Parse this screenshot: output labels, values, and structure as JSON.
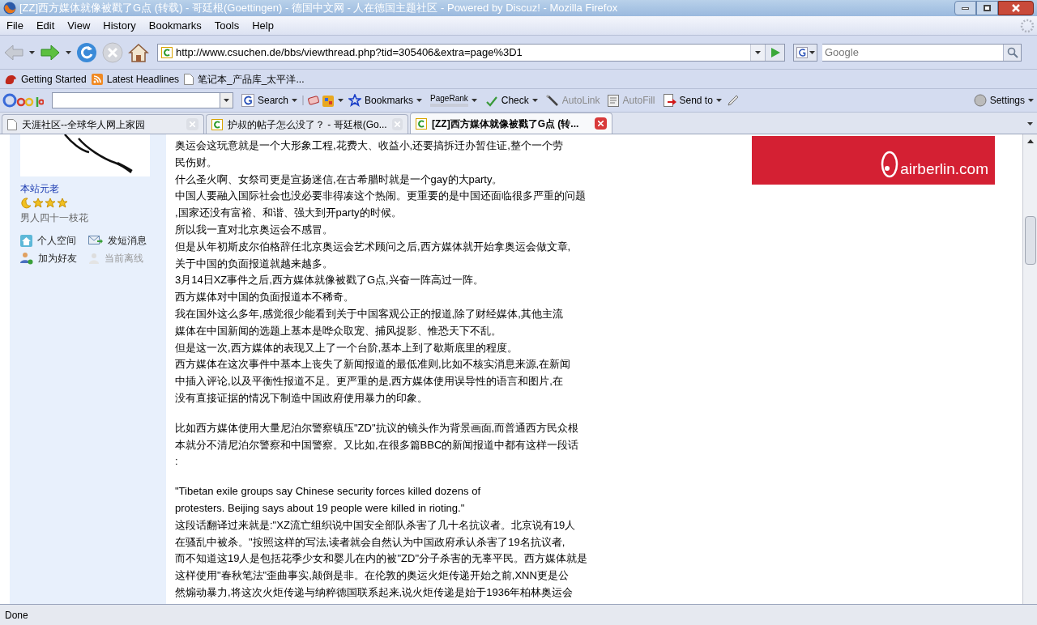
{
  "window": {
    "title": "[ZZ]西方媒体就像被戳了G点 (转载) - 哥廷根(Goettingen) - 德国中文网 - 人在德国主题社区 - Powered by Discuz! - Mozilla Firefox"
  },
  "menu": [
    "File",
    "Edit",
    "View",
    "History",
    "Bookmarks",
    "Tools",
    "Help"
  ],
  "address": {
    "value": "http://www.csuchen.de/bbs/viewthread.php?tid=305406&extra=page%3D1"
  },
  "search": {
    "placeholder": "Google"
  },
  "bookmarks": [
    {
      "label": "Getting Started",
      "kind": "firefox"
    },
    {
      "label": "Latest Headlines",
      "kind": "feed"
    },
    {
      "label": "笔记本_产品库_太平洋...",
      "kind": "page"
    }
  ],
  "google_toolbar": {
    "items": [
      {
        "label": "Search",
        "kind": "search",
        "disabled": false
      },
      {
        "label": "Bookmarks",
        "kind": "bookmarks",
        "disabled": false
      },
      {
        "label": "PageRank",
        "kind": "pagerank",
        "disabled": false
      },
      {
        "label": "Check",
        "kind": "check",
        "disabled": false
      },
      {
        "label": "AutoLink",
        "kind": "autolink",
        "disabled": true
      },
      {
        "label": "AutoFill",
        "kind": "autofill",
        "disabled": true
      },
      {
        "label": "Send to",
        "kind": "sendto",
        "disabled": false
      }
    ],
    "settings": "Settings"
  },
  "tabs": [
    {
      "label": "天涯社区--全球华人网上家园",
      "selected": false,
      "kind": "page"
    },
    {
      "label": "护叔的帖子怎么没了？ - 哥廷根(Go...",
      "selected": false,
      "kind": "site"
    },
    {
      "label": "[ZZ]西方媒体就像被戳了G点 (转...",
      "selected": true,
      "kind": "site"
    }
  ],
  "author": {
    "rank": "本站元老",
    "nickname": "男人四十一枝花",
    "actions": [
      {
        "label": "个人空间",
        "kind": "home",
        "disabled": false
      },
      {
        "label": "发短消息",
        "kind": "message",
        "disabled": false
      },
      {
        "label": "加为好友",
        "kind": "friend",
        "disabled": false
      },
      {
        "label": "当前离线",
        "kind": "offline",
        "disabled": true
      }
    ]
  },
  "ad": {
    "text": "airberlin.com"
  },
  "post": {
    "paragraphs": [
      [
        "奥运会这玩意就是一个大形象工程,花费大、收益小,还要搞拆迁办暂住证,整个一个劳",
        "民伤财。",
        "什么圣火啊、女祭司更是宣扬迷信,在古希腊时就是一个gay的大party。",
        "中国人要融入国际社会也没必要非得凑这个热闹。更重要的是中国还面临很多严重的问题",
        ",国家还没有富裕、和谐、强大到开party的时候。",
        "所以我一直对北京奥运会不感冒。",
        "但是从年初斯皮尔伯格辞任北京奥运会艺术顾问之后,西方媒体就开始拿奥运会做文章,",
        "关于中国的负面报道就越来越多。",
        "3月14日XZ事件之后,西方媒体就像被戳了G点,兴奋一阵高过一阵。",
        "西方媒体对中国的负面报道本不稀奇。",
        "我在国外这么多年,感觉很少能看到关于中国客观公正的报道,除了财经媒体,其他主流",
        "媒体在中国新闻的选题上基本是哗众取宠、捕风捉影、惟恐天下不乱。",
        "但是这一次,西方媒体的表现又上了一个台阶,基本上到了歇斯底里的程度。",
        "西方媒体在这次事件中基本上丧失了新闻报道的最低准则,比如不核实消息来源,在新闻",
        "中插入评论,以及平衡性报道不足。更严重的是,西方媒体使用误导性的语言和图片,在",
        "没有直接证据的情况下制造中国政府使用暴力的印象。"
      ],
      [
        "比如西方媒体使用大量尼泊尔警察镇压\"ZD\"抗议的镜头作为背景画面,而普通西方民众根",
        "本就分不清尼泊尔警察和中国警察。又比如,在很多篇BBC的新闻报道中都有这样一段话",
        ":"
      ],
      [
        "\"Tibetan exile groups say Chinese security forces killed dozens of",
        "protesters. Beijing says about 19 people were killed in rioting.\"",
        "这段话翻译过来就是:\"XZ流亡组织说中国安全部队杀害了几十名抗议者。北京说有19人",
        "在骚乱中被杀。\"按照这样的写法,读者就会自然认为中国政府承认杀害了19名抗议者,",
        "而不知道这19人是包括花季少女和婴儿在内的被\"ZD\"分子杀害的无辜平民。西方媒体就是",
        "这样使用\"春秋笔法\"歪曲事实,颠倒是非。在伦敦的奥运火炬传递开始之前,XNN更是公",
        "然煽动暴力,将这次火炬传递与纳粹德国联系起来,说火炬传递是始于1936年柏林奥运会"
      ]
    ]
  },
  "status_bar": {
    "text": "Done"
  }
}
